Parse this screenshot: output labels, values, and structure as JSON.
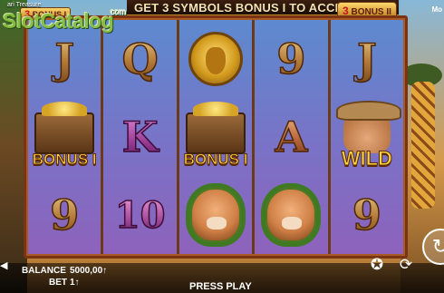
{
  "header": {
    "game_name": "ari Treasure",
    "banner": "GET 3 SYMBOLS BONUS I TO ACCESS TH",
    "badge_left_num": "3",
    "badge_left_text": "BONUS I",
    "badge_right_num": "3",
    "badge_right_text": "BONUS II",
    "more_label": "Mo"
  },
  "watermark": {
    "logo": "SlotCatalog",
    "suffix": "com"
  },
  "reels": [
    [
      {
        "type": "letter",
        "value": "J"
      },
      {
        "type": "bonus",
        "label": "BONUS I"
      },
      {
        "type": "letter",
        "value": "9"
      }
    ],
    [
      {
        "type": "letter",
        "value": "Q"
      },
      {
        "type": "letter",
        "value": "K",
        "style": "k"
      },
      {
        "type": "letter",
        "value": "10",
        "style": "ten"
      }
    ],
    [
      {
        "type": "lion"
      },
      {
        "type": "bonus",
        "label": "BONUS I"
      },
      {
        "type": "cougar"
      }
    ],
    [
      {
        "type": "letter",
        "value": "9"
      },
      {
        "type": "letter",
        "value": "A",
        "style": "a"
      },
      {
        "type": "cougar"
      }
    ],
    [
      {
        "type": "letter",
        "value": "J"
      },
      {
        "type": "wild",
        "label": "WILD"
      },
      {
        "type": "letter",
        "value": "9"
      }
    ]
  ],
  "footer": {
    "balance_label": "BALANCE",
    "balance_value": "5000,00↑",
    "bet_label": "BET",
    "bet_value": "1↑",
    "press_play": "PRESS PLAY"
  },
  "icons": {
    "sound": "sound-icon",
    "settings": "settings-icon",
    "autoplay": "autoplay-icon",
    "spin": "spin-icon"
  },
  "colors": {
    "reel_top": "#5d8ad0",
    "reel_bottom": "#8e62bc",
    "frame": "#6b3a17",
    "bonus_text": "#ffd33a"
  }
}
